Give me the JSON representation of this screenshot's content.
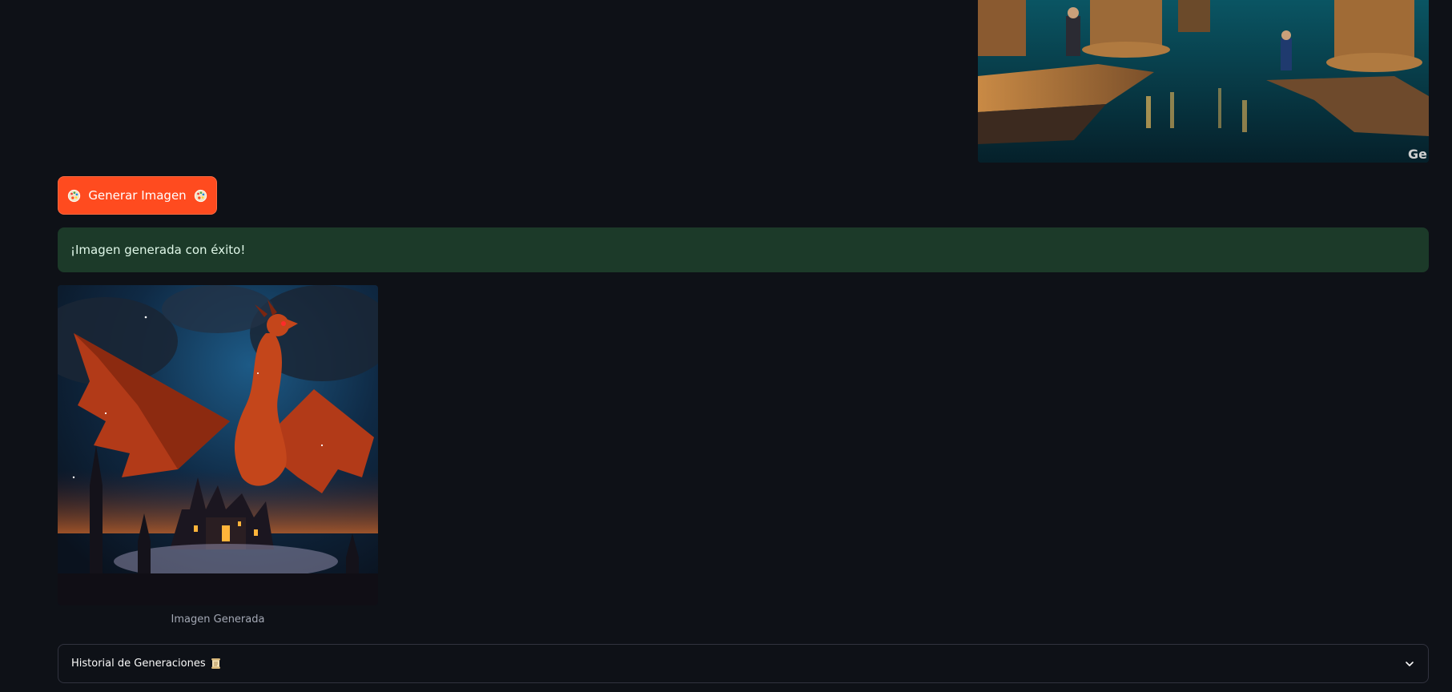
{
  "generate_button": {
    "label": "Generar Imagen",
    "icon_left": "palette-icon",
    "icon_right": "palette-icon",
    "color": "#ff4b1f"
  },
  "alert": {
    "message": "¡Imagen generada con éxito!",
    "color": "#1c3a29"
  },
  "generated_image": {
    "caption": "Imagen Generada"
  },
  "top_image": {
    "watermark": "Ge"
  },
  "expander": {
    "title": "Historial de Generaciones",
    "icon": "scroll-icon",
    "toggle_icon": "chevron-down-icon",
    "expanded": false
  },
  "theme": {
    "background": "#0e1117",
    "text": "#fafafa",
    "border": "#31333f"
  }
}
